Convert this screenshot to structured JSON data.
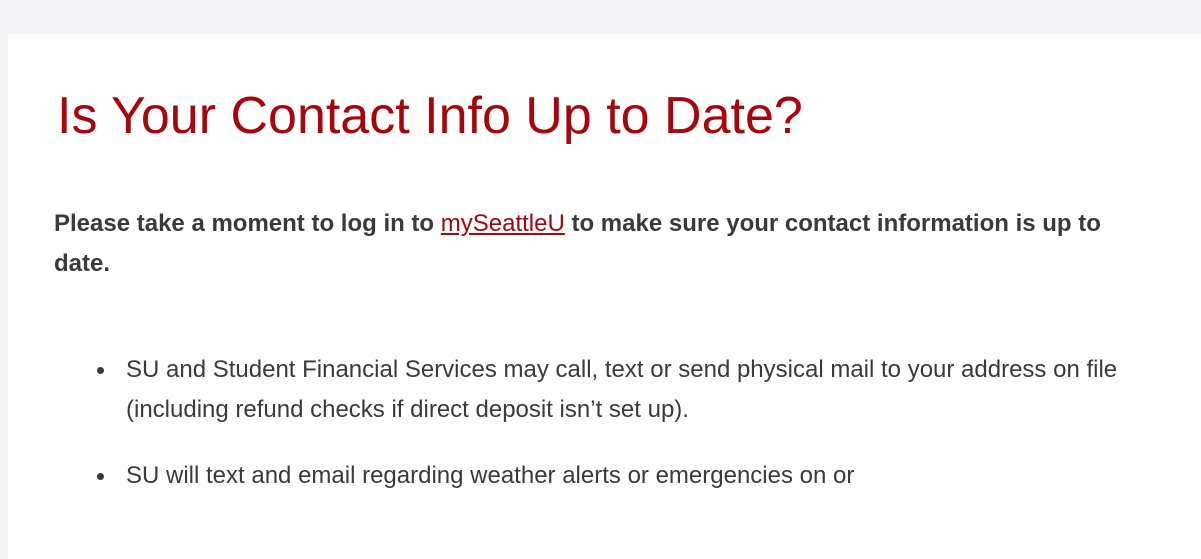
{
  "article": {
    "title": "Is Your Contact Info Up to Date?",
    "lead_before": "Please take a moment to log in to ",
    "lead_link": "mySeattleU",
    "lead_after": " to make sure your contact information is up to date.",
    "bullets": [
      "SU and Student Financial Services may call, text or send physical mail to your address on file (including refund checks if direct deposit isn’t set up).",
      "SU will text and email regarding weather alerts or emergencies on or"
    ]
  },
  "colors": {
    "page_background": "#f4f4f7",
    "card_background": "#ffffff",
    "title": "#a6060c",
    "link": "#a6060c",
    "body_text": "#3a3a3a"
  }
}
